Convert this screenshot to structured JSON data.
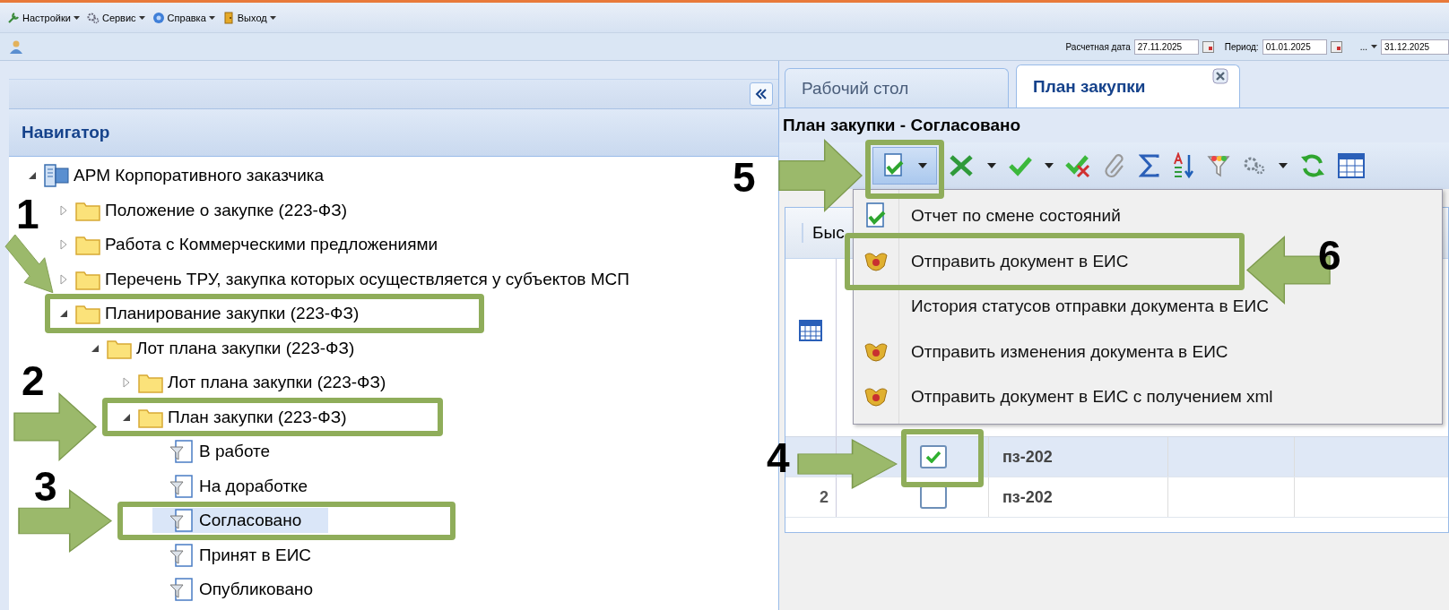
{
  "menu_bar": [
    {
      "label": "Настройки"
    },
    {
      "label": "Сервис"
    },
    {
      "label": "Справка"
    },
    {
      "label": "Выход"
    }
  ],
  "date_bar": {
    "calc_date_label": "Расчетная дата",
    "calc_date": "27.11.2025",
    "period_label": "Период:",
    "period_from": "01.01.2025",
    "period_separator": "...",
    "period_to": "31.12.2025"
  },
  "navigator": {
    "title": "Навигатор",
    "tree": [
      {
        "label": "АРМ Корпоративного заказчика",
        "kind": "workstation",
        "expanded": true,
        "selected": false,
        "children": [
          {
            "label": "Положение о закупке (223-ФЗ)",
            "kind": "folder",
            "expanded": false,
            "selected": false
          },
          {
            "label": "Работа с Коммерческими предложениями",
            "kind": "folder",
            "expanded": false,
            "selected": false
          },
          {
            "label": "Перечень ТРУ, закупка которых осуществляется у субъектов МСП",
            "kind": "folder",
            "expanded": false,
            "selected": false
          },
          {
            "label": "Планирование закупки (223-ФЗ)",
            "kind": "folder",
            "expanded": true,
            "selected": false,
            "children": [
              {
                "label": "Лот плана закупки (223-ФЗ)",
                "kind": "folder",
                "expanded": true,
                "selected": false,
                "children": [
                  {
                    "label": "Лот плана закупки (223-ФЗ)",
                    "kind": "folder",
                    "expanded": false,
                    "selected": false
                  },
                  {
                    "label": "План закупки (223-ФЗ)",
                    "kind": "folder",
                    "expanded": true,
                    "selected": false,
                    "children": [
                      {
                        "label": "В работе",
                        "kind": "filter",
                        "selected": false
                      },
                      {
                        "label": "На доработке",
                        "kind": "filter",
                        "selected": false
                      },
                      {
                        "label": "Согласовано",
                        "kind": "filter",
                        "selected": true
                      },
                      {
                        "label": "Принят в ЕИС",
                        "kind": "filter",
                        "selected": false
                      },
                      {
                        "label": "Опубликовано",
                        "kind": "filter",
                        "selected": false
                      }
                    ]
                  }
                ]
              }
            ]
          }
        ]
      }
    ]
  },
  "tabs": [
    {
      "label": "Рабочий стол",
      "selected": false
    },
    {
      "label": "План закупки",
      "selected": true
    }
  ],
  "panel_title": "План закупки - Согласовано",
  "grid": {
    "column_1": "Быс",
    "rows": [
      {
        "number": "",
        "checked": true,
        "selected": true,
        "column_2": "пз-202"
      },
      {
        "number": "2",
        "checked": false,
        "selected": false,
        "column_2": "пз-202"
      }
    ]
  },
  "dropdown_menu": [
    {
      "label": "Отчет по смене состояний",
      "kind": "doc-check"
    },
    {
      "label": "Отправить документ в ЕИС",
      "kind": "emblem"
    },
    {
      "label": "История статусов отправки документа в ЕИС",
      "kind": "none"
    },
    {
      "label": "Отправить изменения документа в ЕИС",
      "kind": "emblem"
    },
    {
      "label": "Отправить документ в ЕИС с получением xml",
      "kind": "emblem"
    }
  ],
  "annotations": [
    {
      "number": "1"
    },
    {
      "number": "2"
    },
    {
      "number": "3"
    },
    {
      "number": "4"
    },
    {
      "number": "5"
    },
    {
      "number": "6"
    }
  ]
}
